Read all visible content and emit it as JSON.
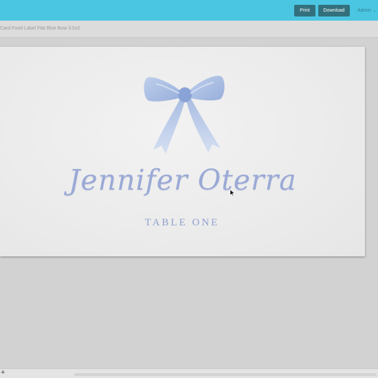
{
  "toolbar": {
    "print_label": "Print",
    "download_label": "Download",
    "user_label": "Admin ⌄"
  },
  "document": {
    "title": "Card Food Label Flat Blue Bow 3.5x2"
  },
  "card": {
    "guest_name": "Jennifer Oterra",
    "table_label": "TABLE ONE"
  },
  "footer": {
    "add_label": "+"
  },
  "colors": {
    "topbar": "#4bc6e2",
    "button": "#33707d",
    "card_text": "#9aa9d6",
    "bow": "#a9bde3"
  },
  "icons": [
    "bow-illustration",
    "mouse-cursor-icon",
    "plus-icon"
  ]
}
